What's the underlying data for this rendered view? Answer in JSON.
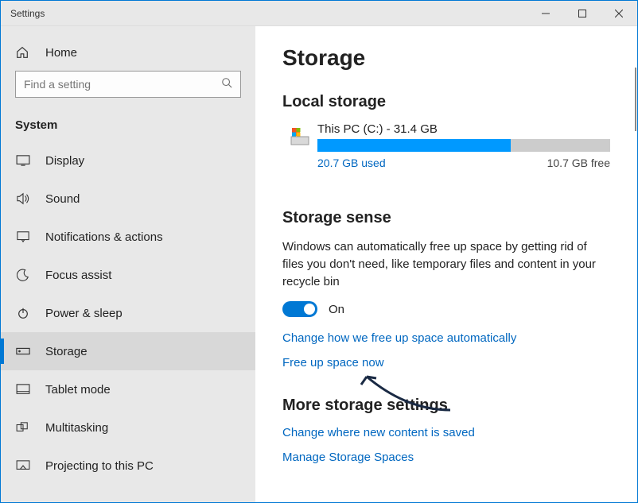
{
  "window": {
    "title": "Settings"
  },
  "sidebar": {
    "home": "Home",
    "search_placeholder": "Find a setting",
    "category": "System",
    "items": [
      {
        "label": "Display"
      },
      {
        "label": "Sound"
      },
      {
        "label": "Notifications & actions"
      },
      {
        "label": "Focus assist"
      },
      {
        "label": "Power & sleep"
      },
      {
        "label": "Storage"
      },
      {
        "label": "Tablet mode"
      },
      {
        "label": "Multitasking"
      },
      {
        "label": "Projecting to this PC"
      }
    ]
  },
  "page": {
    "title": "Storage",
    "local_heading": "Local storage",
    "disk": {
      "name": "This PC (C:) - 31.4 GB",
      "used_label": "20.7 GB used",
      "free_label": "10.7 GB free",
      "used_pct": 65.9
    },
    "sense_heading": "Storage sense",
    "sense_desc": "Windows can automatically free up space by getting rid of files you don't need, like temporary files and content in your recycle bin",
    "toggle_label": "On",
    "link_change": "Change how we free up space automatically",
    "link_free": "Free up space now",
    "more_heading": "More storage settings",
    "link_where": "Change where new content is saved",
    "link_spaces": "Manage Storage Spaces"
  }
}
